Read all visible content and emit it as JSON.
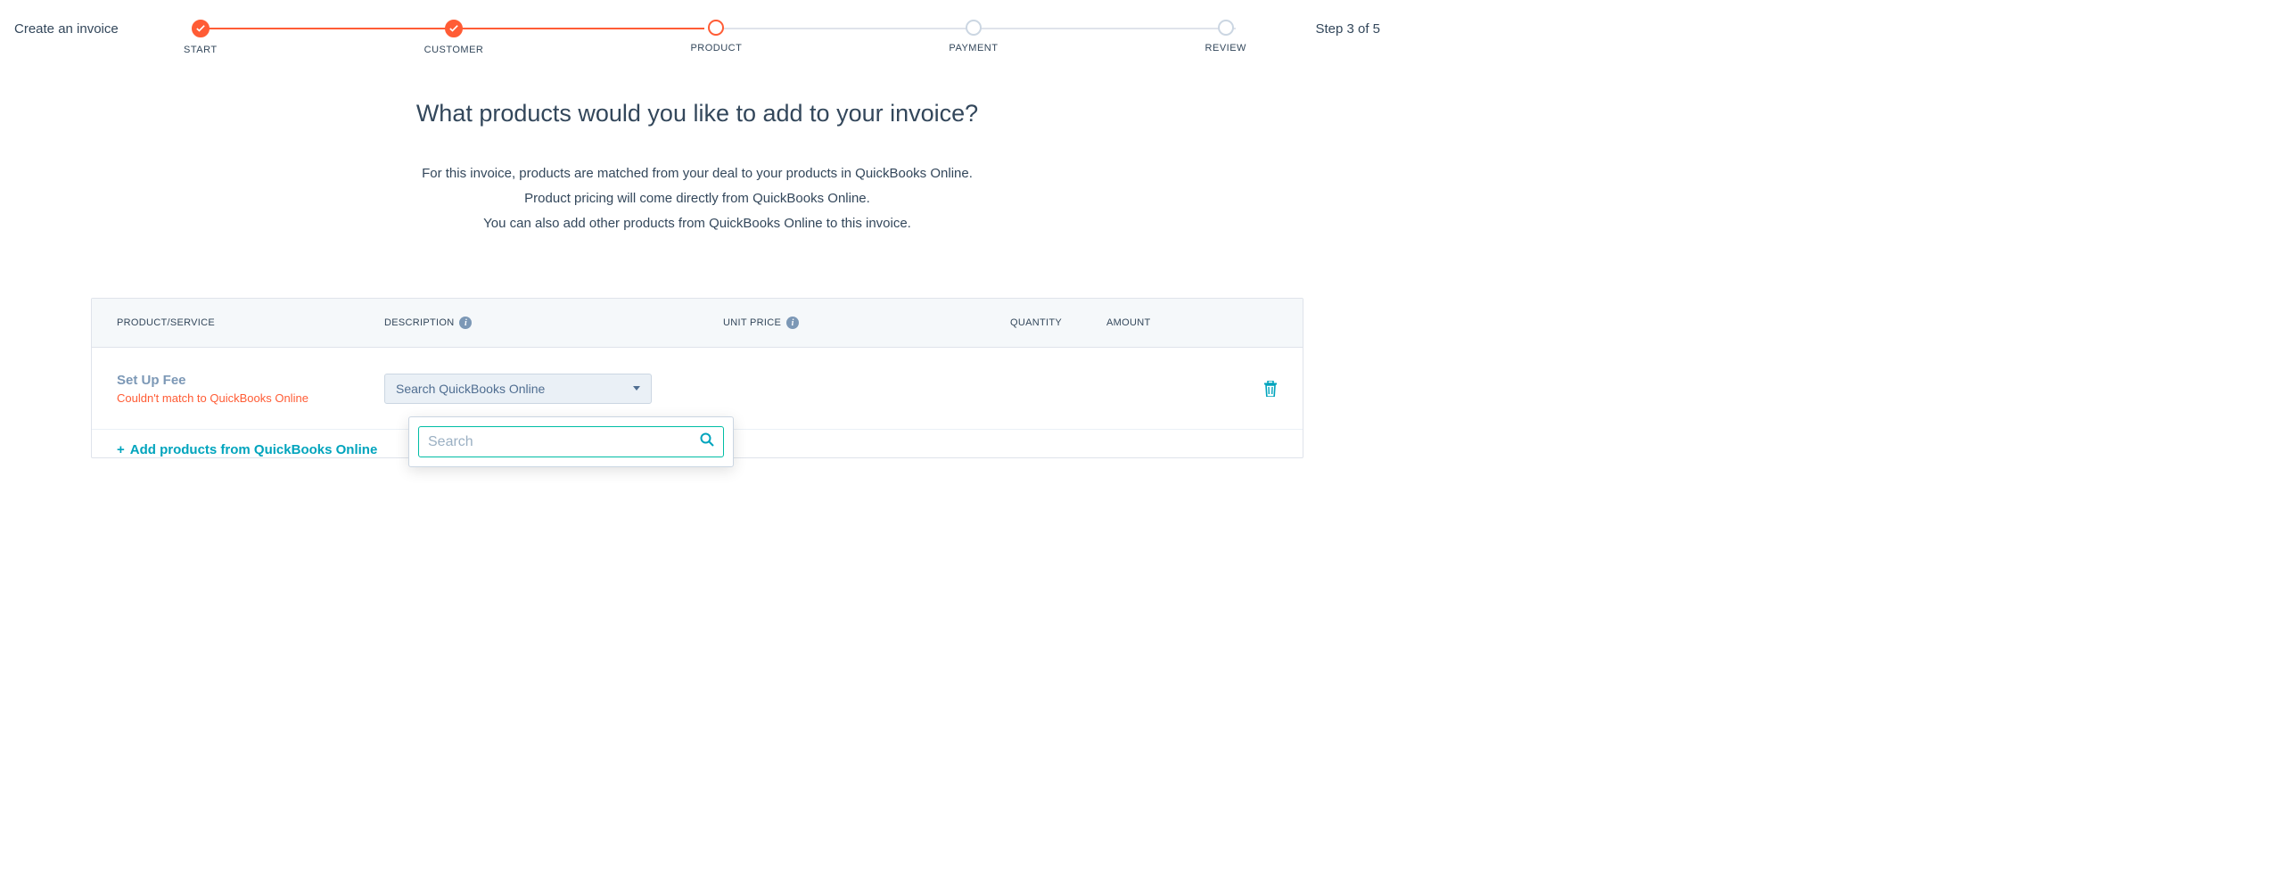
{
  "header": {
    "title": "Create an invoice",
    "step_indicator": "Step 3 of 5"
  },
  "stepper": {
    "steps": [
      {
        "label": "START",
        "state": "done"
      },
      {
        "label": "CUSTOMER",
        "state": "done"
      },
      {
        "label": "PRODUCT",
        "state": "active"
      },
      {
        "label": "PAYMENT",
        "state": "todo"
      },
      {
        "label": "REVIEW",
        "state": "todo"
      }
    ]
  },
  "main": {
    "title": "What products would you like to add to your invoice?",
    "desc_line1": "For this invoice, products are matched from your deal to your products in QuickBooks Online.",
    "desc_line2": "Product pricing will come directly from QuickBooks Online.",
    "desc_line3": "You can also add other products from QuickBooks Online to this invoice."
  },
  "table": {
    "headers": {
      "product": "PRODUCT/SERVICE",
      "description": "DESCRIPTION",
      "unit_price": "UNIT PRICE",
      "quantity": "QUANTITY",
      "amount": "AMOUNT"
    },
    "rows": [
      {
        "name": "Set Up Fee",
        "error": "Couldn't match to QuickBooks Online",
        "desc_select_label": "Search QuickBooks Online"
      }
    ],
    "add_link": "Add products from QuickBooks Online"
  },
  "dropdown": {
    "search_placeholder": "Search"
  },
  "icons": {
    "info": "i"
  }
}
